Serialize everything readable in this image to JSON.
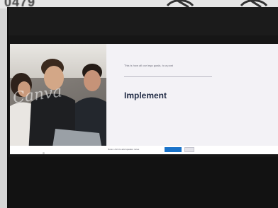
{
  "background": {
    "digits": "0479",
    "icons": [
      "wifi-off-icon",
      "wifi-off-icon"
    ]
  },
  "slide": {
    "subtitle": "This is how all our lego goals, to a post",
    "heading": "Implement",
    "watermark": "Canva"
  },
  "footer": {
    "label": "Notes: click to add speaker notes",
    "primary_button": "",
    "secondary_button": ""
  },
  "colors": {
    "screen": "#161616",
    "slide_bg": "#f3f2f6",
    "heading": "#1f2a44",
    "accent_button": "#1a73c9"
  }
}
